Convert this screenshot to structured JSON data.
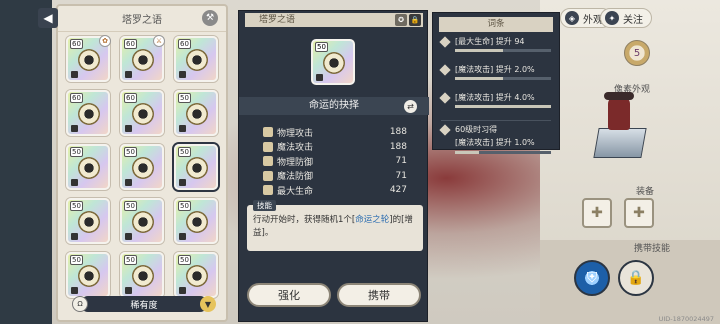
{
  "top_buttons": [
    {
      "icon": "outfit-icon",
      "label": "外观"
    },
    {
      "icon": "follow-icon",
      "label": "关注"
    }
  ],
  "left_panel": {
    "title": "塔罗之语",
    "rarity_label": "稀有度",
    "rarity_left": "Ω",
    "rarity_right": "▼",
    "cards": [
      {
        "level": "60",
        "badge": "✿"
      },
      {
        "level": "60",
        "badge": "⚔"
      },
      {
        "level": "60",
        "badge": ""
      },
      {
        "level": "60",
        "badge": ""
      },
      {
        "level": "60",
        "badge": ""
      },
      {
        "level": "50",
        "badge": ""
      },
      {
        "level": "50",
        "badge": ""
      },
      {
        "level": "50",
        "badge": ""
      },
      {
        "level": "50",
        "badge": ""
      },
      {
        "level": "50",
        "badge": ""
      },
      {
        "level": "50",
        "badge": ""
      },
      {
        "level": "50",
        "badge": ""
      },
      {
        "level": "50",
        "badge": ""
      },
      {
        "level": "50",
        "badge": ""
      },
      {
        "level": "50",
        "badge": ""
      }
    ],
    "selected_index": 8
  },
  "detail": {
    "title": "塔罗之语",
    "card_level": "50",
    "card_name": "命运的抉择",
    "stats": [
      {
        "label": "物理攻击",
        "value": "188"
      },
      {
        "label": "魔法攻击",
        "value": "188"
      },
      {
        "label": "物理防御",
        "value": "71"
      },
      {
        "label": "魔法防御",
        "value": "71"
      },
      {
        "label": "最大生命",
        "value": "427"
      }
    ],
    "skill_tag": "技能",
    "skill_text_1": "行动开始时，获得随机1个[",
    "skill_text_hl": "命运之轮",
    "skill_text_2": "]的[增益]。",
    "enhance_button": "强化",
    "equip_button": "携带"
  },
  "entries": {
    "title": "词条",
    "items": [
      {
        "text": "[最大生命] 提升 94",
        "progress": 0.5
      },
      {
        "text": "[魔法攻击] 提升 2.0%",
        "progress": 0.5
      },
      {
        "text": "[魔法攻击] 提升 4.0%",
        "progress": 1.0
      }
    ],
    "unlock_title": "60级时习得",
    "unlock_text": "[魔法攻击] 提升 1.0%",
    "unlock_progress": 0.25
  },
  "right": {
    "level_badge": "5",
    "appearance_label": "像素外观",
    "equipment_label": "装备",
    "carry_skill_label": "携带技能",
    "uid": "UID-1870024497"
  }
}
